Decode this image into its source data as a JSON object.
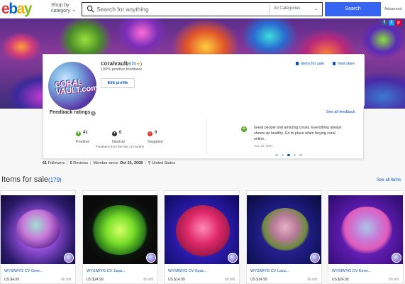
{
  "header": {
    "logo_letters": [
      "e",
      "b",
      "a",
      "y"
    ],
    "logo_colors": [
      "#e53238",
      "#0064d2",
      "#f5af02",
      "#86b817"
    ],
    "shop_by_category": "Shop by category",
    "search_placeholder": "Search for anything",
    "category_select": "All Categories",
    "search_button": "Search",
    "advanced": "Advanced"
  },
  "share_icons": [
    "f",
    "t",
    "p"
  ],
  "profile": {
    "seller_name": "coralvault",
    "score_open": "(",
    "score": "670",
    "score_close": ")",
    "star_icon": "star-icon",
    "positive_feedback": "100% positive feedback",
    "edit_profile": "Edit profile",
    "items_for_sale_link": "Items for sale",
    "visit_store_link": "Visit store",
    "avatar_text": "CORAL VAULT.com"
  },
  "feedback": {
    "title": "Feedback ratings",
    "see_all": "See all feedback",
    "stats": [
      {
        "icon": "plus-icon",
        "symbol": "+",
        "count": "41",
        "label": "Positive",
        "color": "#5ba829"
      },
      {
        "icon": "neutral-icon",
        "symbol": "•",
        "count": "0",
        "label": "Neutral",
        "color": "#333333"
      },
      {
        "icon": "minus-icon",
        "symbol": "–",
        "count": "0",
        "label": "Negative",
        "color": "#d63d27"
      }
    ],
    "note": "Feedback from the last 12 months",
    "review_text": "Great people and amazing corals. Everything always shows up healthy. Go to place when buying coral online.",
    "review_date": "Sep 13, 2021",
    "carousel_dots": 5,
    "carousel_active": 2
  },
  "stats_line": {
    "followers_count": "61",
    "followers_label": "Followers",
    "reviews_count": "0",
    "reviews_label": "Reviews",
    "member_since_label": "Member since:",
    "member_since": "Oct 21, 2008",
    "location": "United States"
  },
  "items_section": {
    "title": "Items for sale",
    "count": "(179)",
    "see_all": "See all items"
  },
  "items": [
    {
      "title": "WYSIWYG CV Gree...",
      "price": "US $4.99",
      "time_left": "6h left"
    },
    {
      "title": "WYSIWYG CV Japa...",
      "price": "US $24.99",
      "time_left": "6h left"
    },
    {
      "title": "WYSIWYG CV Spac...",
      "price": "US $14.99",
      "time_left": "6h left"
    },
    {
      "title": "WYSIWYG CV Lava...",
      "price": "US $14.99",
      "time_left": "6h left"
    },
    {
      "title": "WYSIWYG CV Emer...",
      "price": "US $24.99",
      "time_left": "6h left"
    }
  ],
  "colors": {
    "accent_blue": "#3665f3",
    "link_blue": "#0654ba",
    "positive_green": "#5ba829",
    "negative_red": "#d63d27"
  }
}
